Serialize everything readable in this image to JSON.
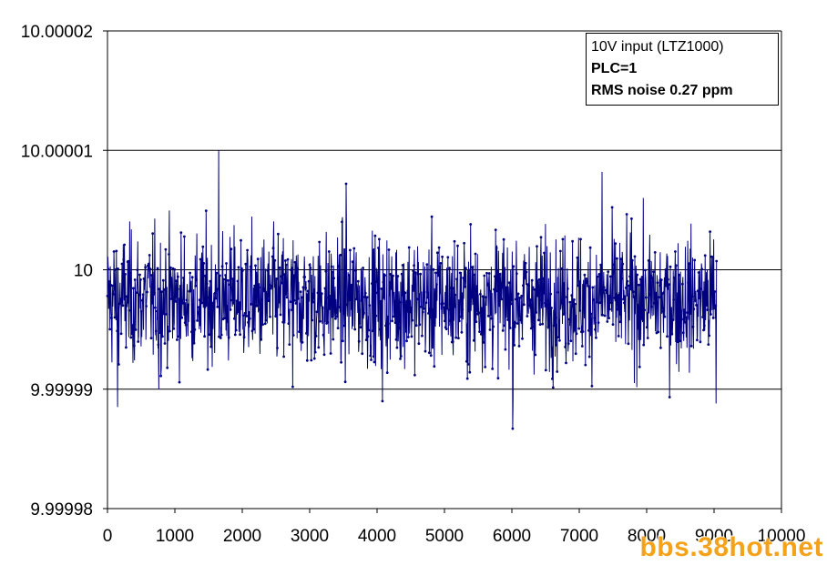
{
  "chart_data": {
    "type": "line",
    "title": "",
    "xlabel": "",
    "ylabel": "",
    "xlim": [
      0,
      10000
    ],
    "ylim": [
      9.99998,
      10.00002
    ],
    "x_ticks": [
      "0",
      "1000",
      "2000",
      "3000",
      "4000",
      "5000",
      "6000",
      "7000",
      "8000",
      "9000",
      "10000"
    ],
    "y_ticks": [
      "10.00002",
      "10.00001",
      "10",
      "9.99999",
      "9.99998"
    ],
    "grid": "horizontal",
    "legend_position": "top-right",
    "series": [
      {
        "color": "#000080",
        "marker": "dot",
        "n_points": 9040,
        "x_range": [
          0,
          9040
        ],
        "mean": 9.9999975,
        "rms_noise_ppm": 0.27,
        "sample_points": [
          {
            "x": 0,
            "y": 9.9999978
          },
          {
            "x": 150,
            "y": 9.9999885
          },
          {
            "x": 760,
            "y": 9.99999
          },
          {
            "x": 1650,
            "y": 10.00001
          },
          {
            "x": 2750,
            "y": 9.9999902
          },
          {
            "x": 3540,
            "y": 10.0000072
          },
          {
            "x": 4080,
            "y": 9.999989
          },
          {
            "x": 6010,
            "y": 9.9999867
          },
          {
            "x": 7340,
            "y": 10.0000082
          },
          {
            "x": 9030,
            "y": 9.9999888
          }
        ]
      }
    ]
  },
  "legend": {
    "line1": "10V input (LTZ1000)",
    "line2": "PLC=1",
    "line3": "RMS noise 0.27 ppm"
  },
  "watermark": "bbs.38hot.net"
}
